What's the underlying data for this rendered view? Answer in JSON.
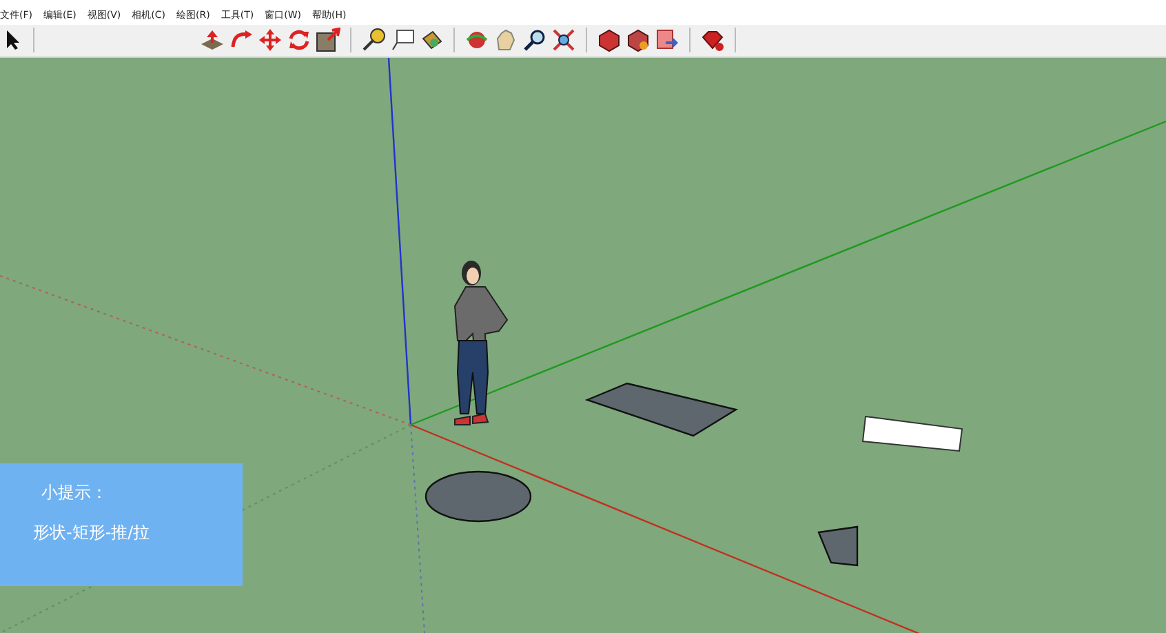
{
  "menu": [
    {
      "label": "文件(F)"
    },
    {
      "label": "编辑(E)"
    },
    {
      "label": "视图(V)"
    },
    {
      "label": "相机(C)"
    },
    {
      "label": "绘图(R)"
    },
    {
      "label": "工具(T)"
    },
    {
      "label": "窗口(W)"
    },
    {
      "label": "帮助(H)"
    }
  ],
  "hint": {
    "title": "小提示：",
    "text": "形状-矩形-推/拉"
  }
}
